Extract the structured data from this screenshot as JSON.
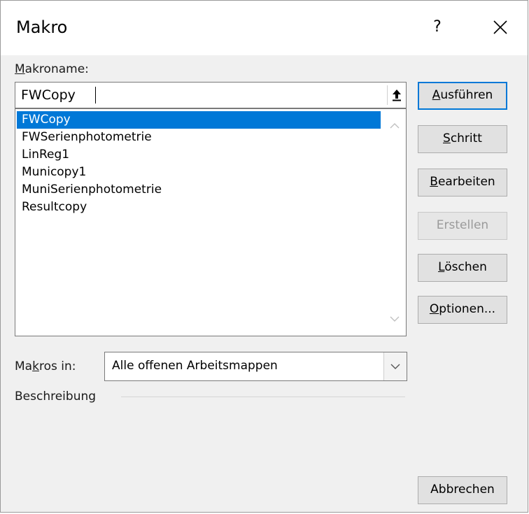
{
  "window": {
    "title": "Makro",
    "help_label": "?"
  },
  "macro_name": {
    "label_prefix": "",
    "label_accel": "M",
    "label_rest": "akroname:",
    "value": "FWCopy"
  },
  "macro_list": {
    "items": [
      "FWCopy",
      "FWSerienphotometrie",
      "LinReg1",
      "Municopy1",
      "MuniSerienphotometrie",
      "Resultcopy"
    ],
    "selected_index": 0
  },
  "buttons": [
    {
      "pre": "",
      "accel": "A",
      "post": "usführen",
      "state": "default"
    },
    {
      "pre": "",
      "accel": "S",
      "post": "chritt",
      "state": "enabled"
    },
    {
      "pre": "",
      "accel": "B",
      "post": "earbeiten",
      "state": "enabled"
    },
    {
      "pre": "Erstellen",
      "accel": "",
      "post": "",
      "state": "disabled"
    },
    {
      "pre": "",
      "accel": "L",
      "post": "öschen",
      "state": "enabled"
    },
    {
      "pre": "",
      "accel": "O",
      "post": "ptionen...",
      "state": "enabled"
    }
  ],
  "macros_in": {
    "label_pre": "Ma",
    "label_accel": "k",
    "label_post": "ros in:",
    "value": "Alle offenen Arbeitsmappen"
  },
  "description": {
    "label": "Beschreibung"
  },
  "cancel_label": "Abbrechen",
  "colors": {
    "selection": "#0078d7",
    "dialog_bg": "#f0f0f0",
    "default_button_border": "#0078d7"
  },
  "icons": {
    "collapse": "upload-arrow-icon",
    "close": "close-x-icon",
    "scroll_up": "chevron-up-icon",
    "scroll_down": "chevron-down-icon",
    "dropdown": "chevron-down-icon"
  }
}
